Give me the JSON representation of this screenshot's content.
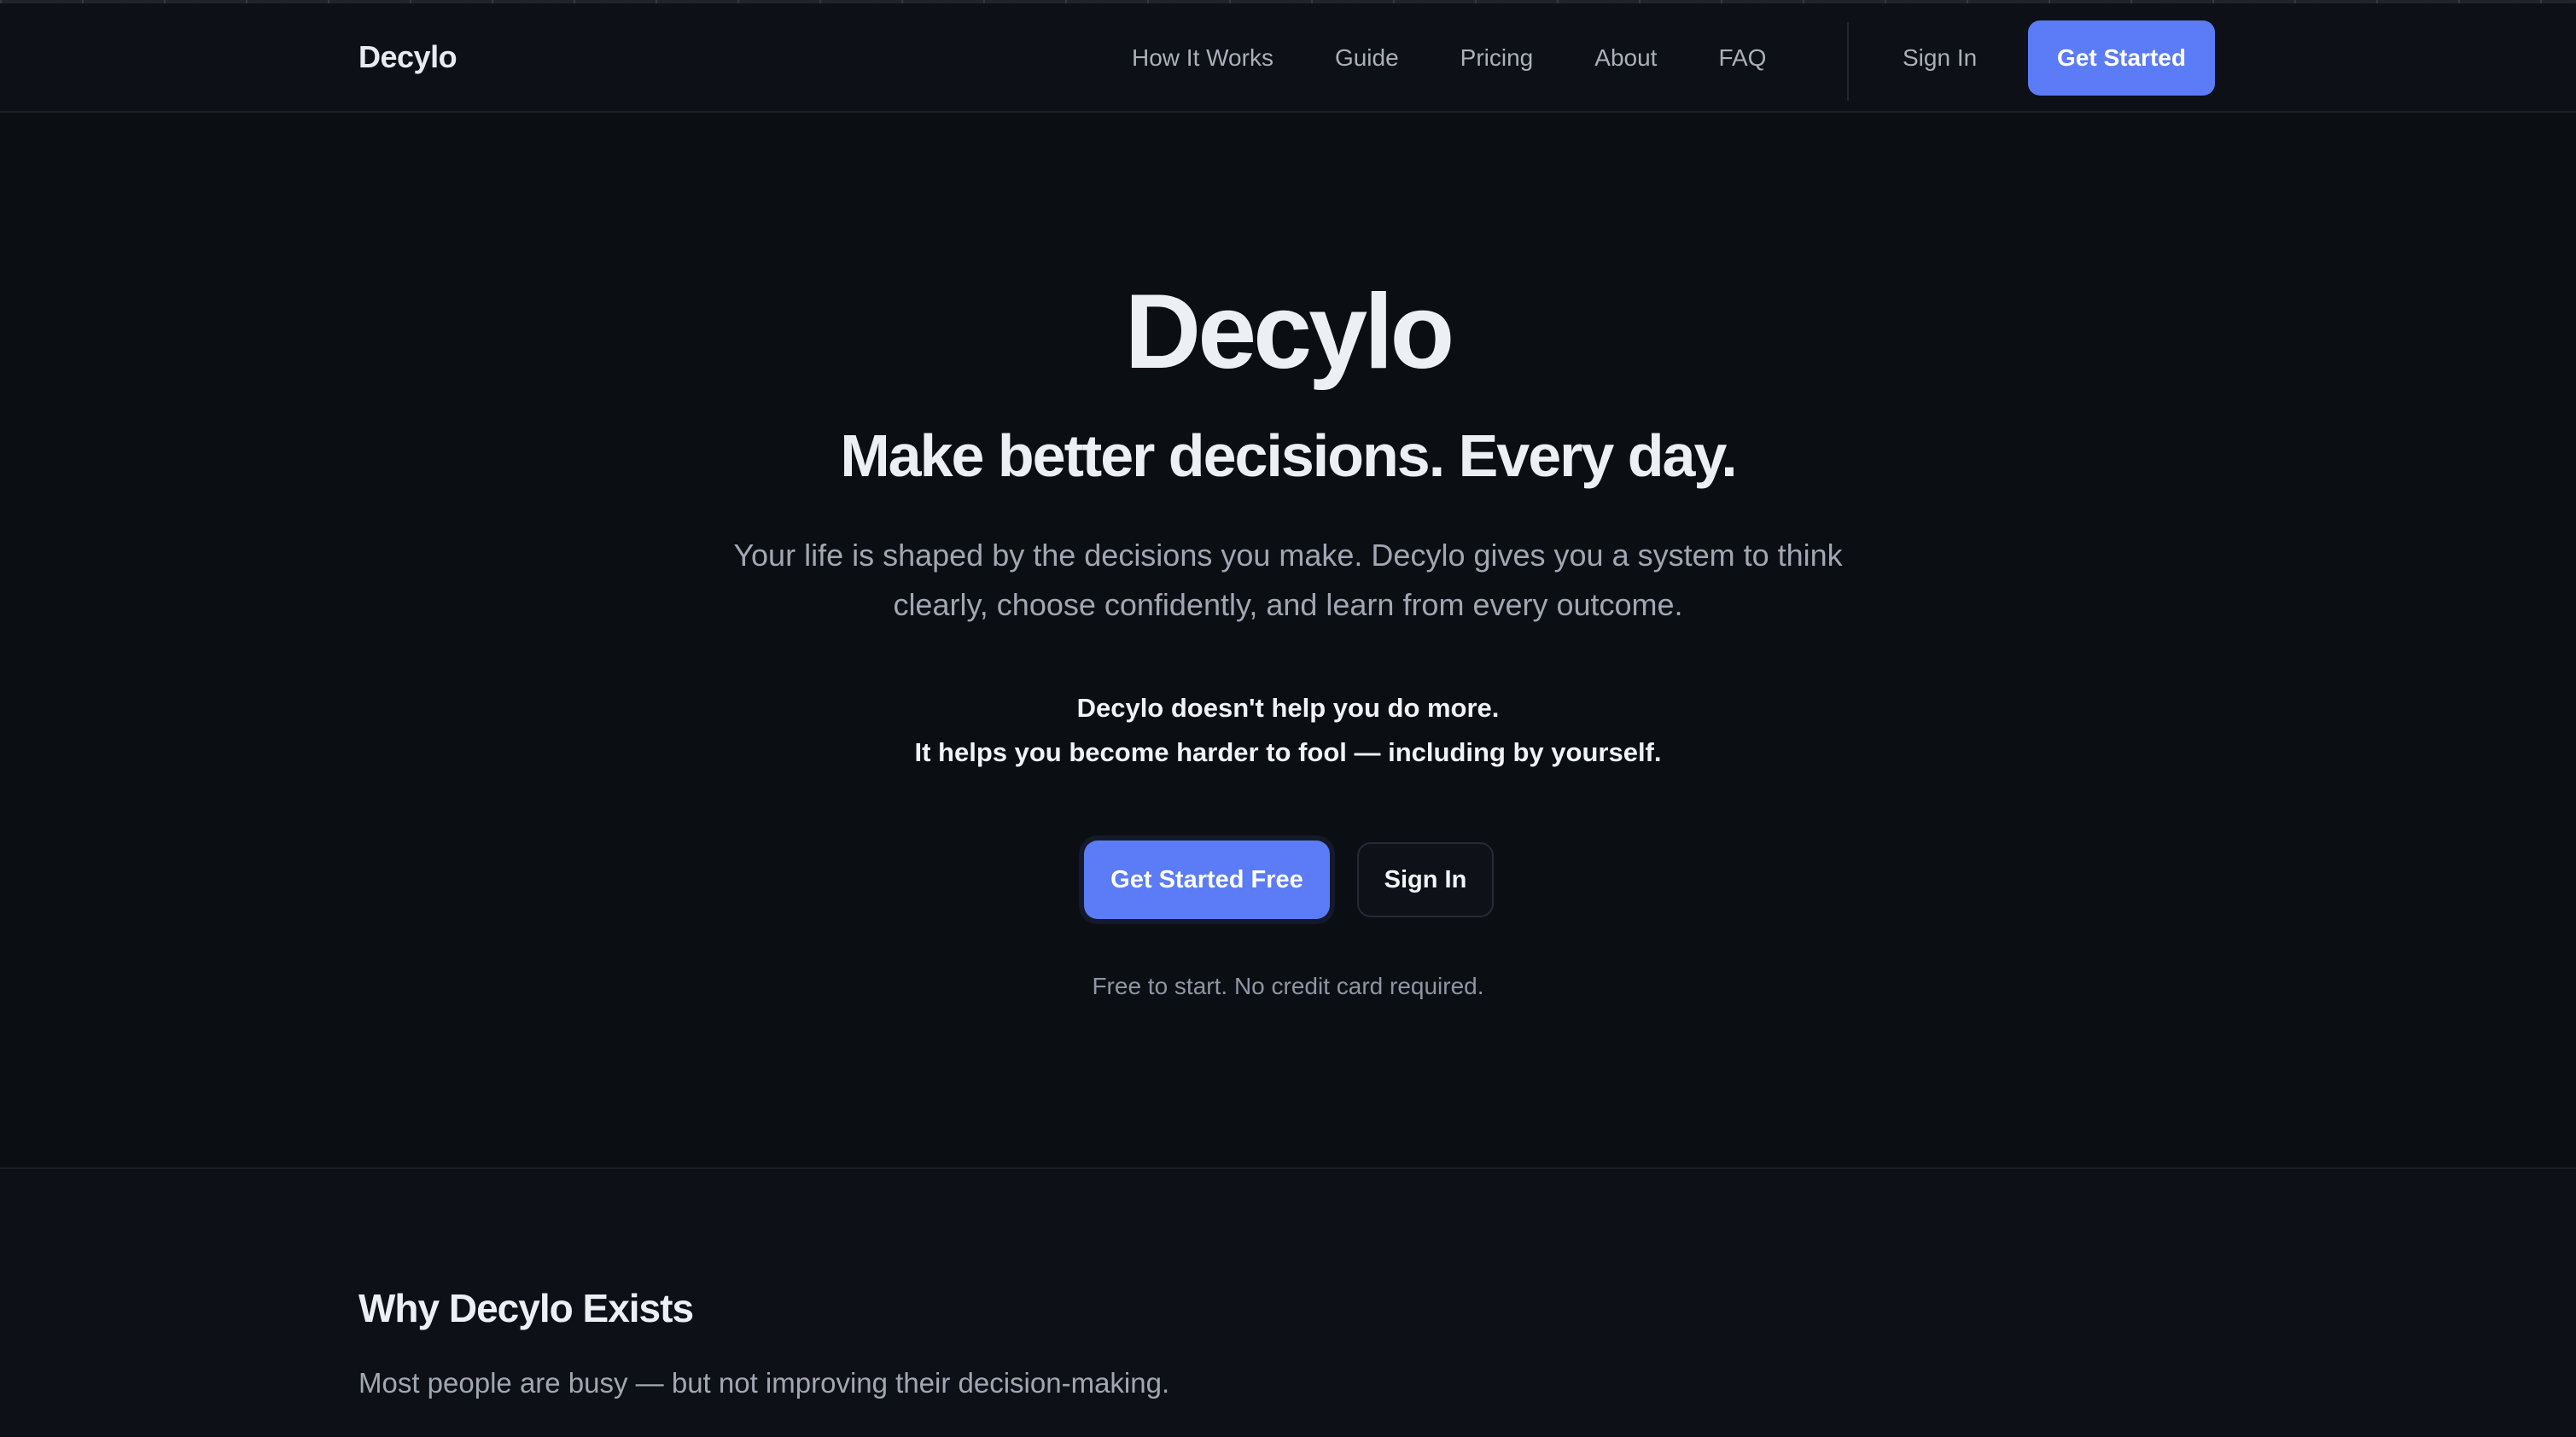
{
  "nav": {
    "brand": "Decylo",
    "links": [
      "How It Works",
      "Guide",
      "Pricing",
      "About",
      "FAQ"
    ],
    "sign_in": "Sign In",
    "cta": "Get Started"
  },
  "hero": {
    "title": "Decylo",
    "subtitle": "Make better decisions. Every day.",
    "description": "Your life is shaped by the decisions you make. Decylo gives you a system to think clearly, choose confidently, and learn from every outcome.",
    "tagline_line1": "Decylo doesn't help you do more.",
    "tagline_line2": "It helps you become harder to fool — including by yourself.",
    "primary_button": "Get Started Free",
    "secondary_button": "Sign In",
    "note": "Free to start. No credit card required."
  },
  "why": {
    "title": "Why Decylo Exists",
    "text": "Most people are busy — but not improving their decision-making."
  },
  "colors": {
    "accent": "#5b7cf6",
    "background": "#0b0e13"
  }
}
